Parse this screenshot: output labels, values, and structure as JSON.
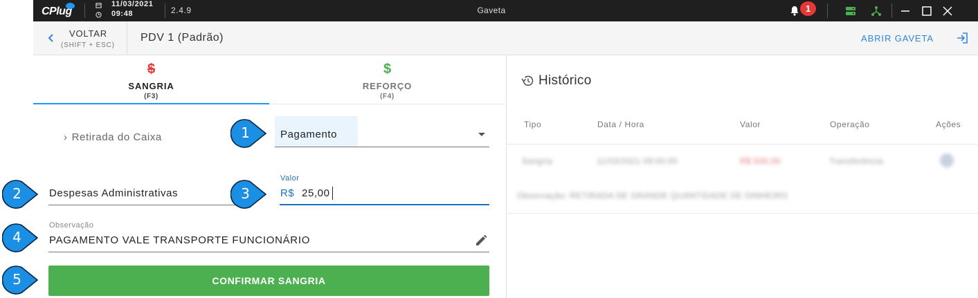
{
  "titlebar": {
    "app_name": "CPlug",
    "date": "11/03/2021",
    "time": "09:48",
    "version": "2.4.9",
    "window_title": "Gaveta",
    "notification_count": "1"
  },
  "header": {
    "back_label": "VOLTAR",
    "back_hint": "(SHIFT + ESC)",
    "title": "PDV 1 (Padrão)",
    "open_drawer_label": "ABRIR GAVETA"
  },
  "tabs": [
    {
      "icon": "$",
      "label": "SANGRIA",
      "shortcut": "(F3)",
      "color": "#e53935",
      "active": true
    },
    {
      "icon": "$",
      "label": "REFORÇO",
      "shortcut": "(F4)",
      "color": "#4caf50",
      "active": false
    }
  ],
  "form": {
    "breadcrumb": "Retirada do Caixa",
    "operation_select": "Pagamento",
    "category_value": "Despesas Administrativas",
    "valor_label": "Valor",
    "valor_currency": "R$",
    "valor_value": "25,00",
    "observacao_label": "Observação",
    "observacao_value": "PAGAMENTO VALE TRANSPORTE FUNCIONÁRIO",
    "confirm_label": "CONFIRMAR SANGRIA"
  },
  "history": {
    "title": "Histórico",
    "columns": [
      "Tipo",
      "Data / Hora",
      "Valor",
      "Operação",
      "Ações"
    ],
    "rows": [
      {
        "tipo": "Sangria",
        "data_hora": "11/03/2021 09:00:00",
        "valor": "R$ 500,00",
        "operacao": "Transferência",
        "observacao": "Observação: RETIRADA DE GRANDE QUANTIDADE DE DINHEIRO"
      }
    ]
  },
  "markers": [
    "1",
    "2",
    "3",
    "4",
    "5"
  ],
  "colors": {
    "accent": "#2196f3",
    "confirm": "#4caf50",
    "sangria_icon": "#e53935",
    "reforco_icon": "#4caf50",
    "marker": "#1a8fe3"
  }
}
